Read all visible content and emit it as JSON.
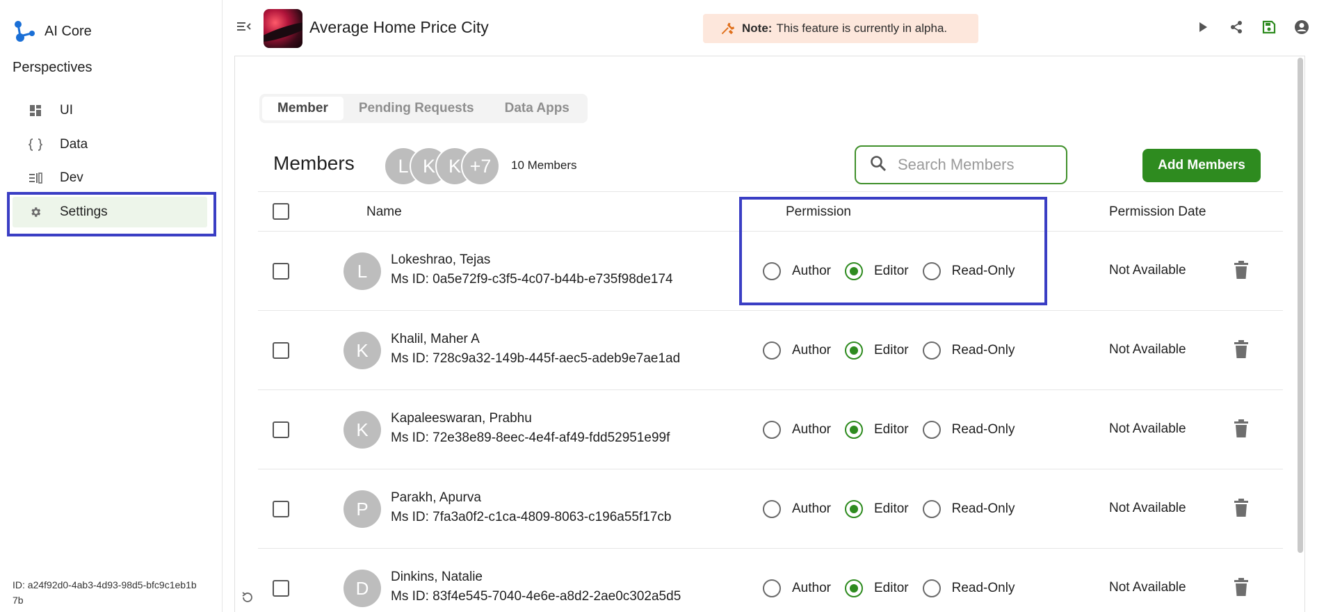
{
  "brand": {
    "name": "AI Core"
  },
  "sidebar": {
    "title": "Perspectives",
    "items": [
      {
        "label": "UI",
        "icon": "dashboard-icon"
      },
      {
        "label": "Data",
        "icon": "braces-icon"
      },
      {
        "label": "Dev",
        "icon": "code-list-icon"
      },
      {
        "label": "Settings",
        "icon": "gear-icon",
        "active": true
      }
    ],
    "footer_id": "ID: a24f92d0-4ab3-4d93-98d5-bfc9c1eb1b7b"
  },
  "header": {
    "app_title": "Average Home Price City",
    "note_label": "Note:",
    "note_text": "This feature is currently in alpha."
  },
  "tabs": [
    {
      "label": "Member",
      "active": true
    },
    {
      "label": "Pending Requests"
    },
    {
      "label": "Data Apps"
    }
  ],
  "members": {
    "title": "Members",
    "stack": [
      "L",
      "K",
      "K",
      "+7"
    ],
    "count_label": "10 Members",
    "search_placeholder": "Search Members",
    "add_button": "Add Members"
  },
  "table": {
    "columns": {
      "name": "Name",
      "permission": "Permission",
      "date": "Permission Date"
    },
    "permission_options": [
      "Author",
      "Editor",
      "Read-Only"
    ],
    "rows": [
      {
        "initial": "L",
        "name": "Lokeshrao, Tejas",
        "id": "Ms ID: 0a5e72f9-c3f5-4c07-b44b-e735f98de174",
        "permission": "Editor",
        "date": "Not Available"
      },
      {
        "initial": "K",
        "name": "Khalil, Maher A",
        "id": "Ms ID: 728c9a32-149b-445f-aec5-adeb9e7ae1ad",
        "permission": "Editor",
        "date": "Not Available"
      },
      {
        "initial": "K",
        "name": "Kapaleeswaran, Prabhu",
        "id": "Ms ID: 72e38e89-8eec-4e4f-af49-fdd52951e99f",
        "permission": "Editor",
        "date": "Not Available"
      },
      {
        "initial": "P",
        "name": "Parakh, Apurva",
        "id": "Ms ID: 7fa3a0f2-c1ca-4809-8063-c196a55f17cb",
        "permission": "Editor",
        "date": "Not Available"
      },
      {
        "initial": "D",
        "name": "Dinkins, Natalie",
        "id": "Ms ID: 83f4e545-7040-4e6e-a8d2-2ae0c302a5d5",
        "permission": "Editor",
        "date": "Not Available"
      }
    ]
  },
  "colors": {
    "accent_green": "#2e8b1f",
    "highlight_blue": "#3a3ec4",
    "note_bg": "#fde7dc",
    "avatar_gray": "#bdbdbd"
  }
}
